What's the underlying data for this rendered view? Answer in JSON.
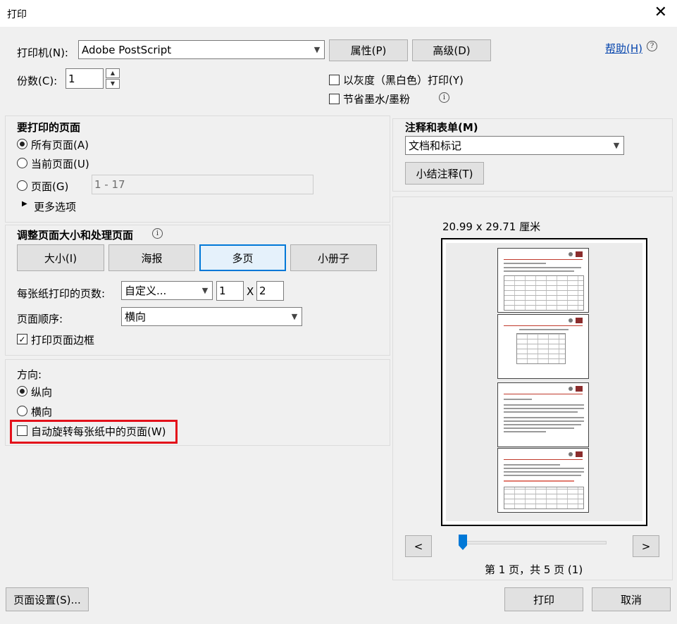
{
  "window": {
    "title": "打印",
    "close_glyph": "✕"
  },
  "printer": {
    "label": "打印机(N):",
    "selected": "Adobe PostScript",
    "properties_button": "属性(P)",
    "advanced_button": "高级(D)",
    "help_link": "帮助(H)",
    "help_icon": "?"
  },
  "copies": {
    "label": "份数(C):",
    "value": "1"
  },
  "options": {
    "grayscale_label": "以灰度（黑白色）打印(Y)",
    "grayscale_checked": false,
    "save_ink_label": "节省墨水/墨粉",
    "save_ink_checked": false,
    "info_glyph": "i"
  },
  "pages_to_print": {
    "heading": "要打印的页面",
    "all_label": "所有页面(A)",
    "current_label": "当前页面(U)",
    "pages_label": "页面(G)",
    "pages_placeholder": "1 - 17",
    "more_options": "更多选项",
    "selected": "all"
  },
  "sizing": {
    "heading": "调整页面大小和处理页面",
    "tabs": [
      "大小(I)",
      "海报",
      "多页",
      "小册子"
    ],
    "selected_tab": "多页",
    "pages_per_sheet_label": "每张纸打印的页数:",
    "pages_per_sheet_value": "自定义...",
    "cols": "1",
    "times": "X",
    "rows": "2",
    "order_label": "页面顺序:",
    "order_value": "横向",
    "border_label": "打印页面边框",
    "border_checked": true,
    "check_glyph": "✓"
  },
  "orientation": {
    "heading": "方向:",
    "portrait_label": "纵向",
    "landscape_label": "横向",
    "auto_rotate_label": "自动旋转每张纸中的页面(W)",
    "auto_rotate_checked": false,
    "selected": "portrait",
    "highlight_color": "#e3101a"
  },
  "comments": {
    "heading": "注释和表单(M)",
    "selected": "文档和标记",
    "summarize_button": "小结注释(T)"
  },
  "preview": {
    "size_text": "20.99 x 29.71 厘米",
    "prev_button": "<",
    "next_button": ">",
    "page_status": "第 1 页，共 5 页 (1)",
    "slider_position": 0.0
  },
  "footer": {
    "page_setup_button": "页面设置(S)...",
    "print_button": "打印",
    "cancel_button": "取消"
  },
  "colors": {
    "accent": "#0078d7",
    "link": "#0645ad"
  }
}
